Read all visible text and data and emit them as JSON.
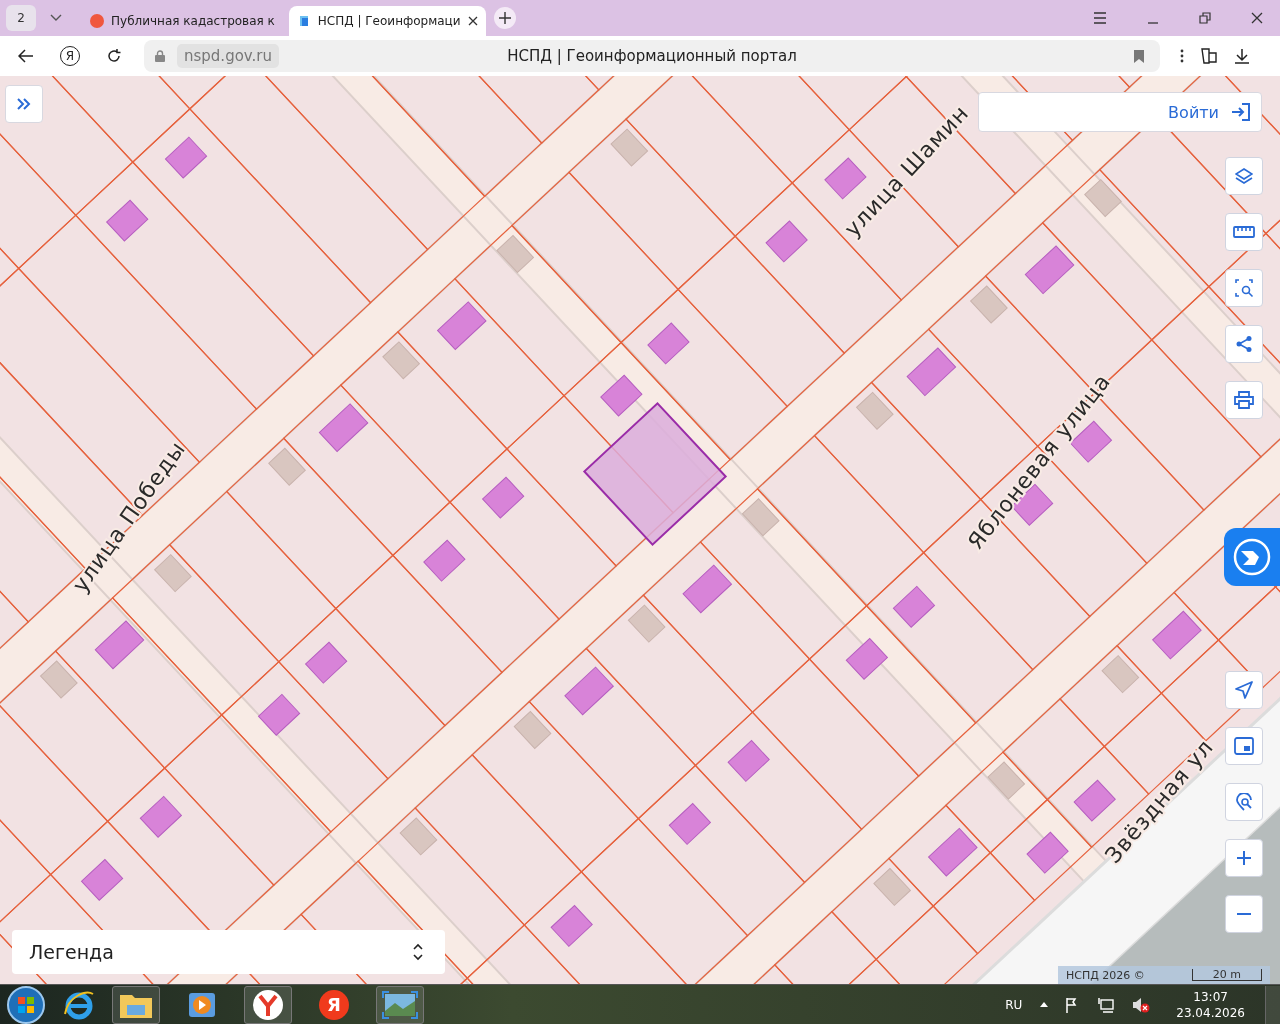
{
  "browser": {
    "tab_count": "2",
    "tabs": [
      {
        "title": "Публичная кадастровая к",
        "selected": false
      },
      {
        "title": "НСПД | Геоинформаци",
        "selected": true
      }
    ],
    "yandex_button": "Я",
    "url": "nspd.gov.ru",
    "page_title": "НСПД | Геоинформационный портал"
  },
  "map": {
    "login_button": "Войти",
    "street_labels": [
      "улица Шамин",
      "улица Победы",
      "Яблоневая улица",
      "Звёздная ул"
    ],
    "legend": "Легенда",
    "attribution": "НСПД 2026 ©",
    "scale": "20 m"
  },
  "taskbar": {
    "yandex_label": "Я",
    "language": "RU",
    "time": "13:07",
    "date": "23.04.2026"
  }
}
